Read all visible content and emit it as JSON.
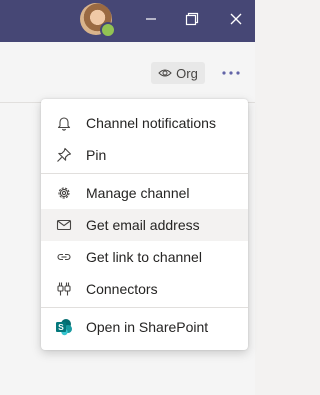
{
  "titlebar": {
    "avatar_status": "available",
    "minimize_icon": "minimize-icon",
    "restore_icon": "restore-icon",
    "close_icon": "close-icon"
  },
  "header": {
    "org_label": "Org",
    "org_icon": "eye-icon",
    "more_icon": "more-options-icon"
  },
  "menu": {
    "items": [
      {
        "label": "Channel notifications",
        "icon": "bell-icon"
      },
      {
        "label": "Pin",
        "icon": "pin-icon"
      },
      {
        "label": "Manage channel",
        "icon": "gear-icon"
      },
      {
        "label": "Get email address",
        "icon": "mail-icon"
      },
      {
        "label": "Get link to channel",
        "icon": "link-icon"
      },
      {
        "label": "Connectors",
        "icon": "connectors-icon"
      },
      {
        "label": "Open in SharePoint",
        "icon": "sharepoint-icon"
      }
    ]
  },
  "colors": {
    "titlebar": "#464775",
    "status_available": "#92c353",
    "sharepoint": "#038387",
    "hover": "#f3f2f1"
  }
}
